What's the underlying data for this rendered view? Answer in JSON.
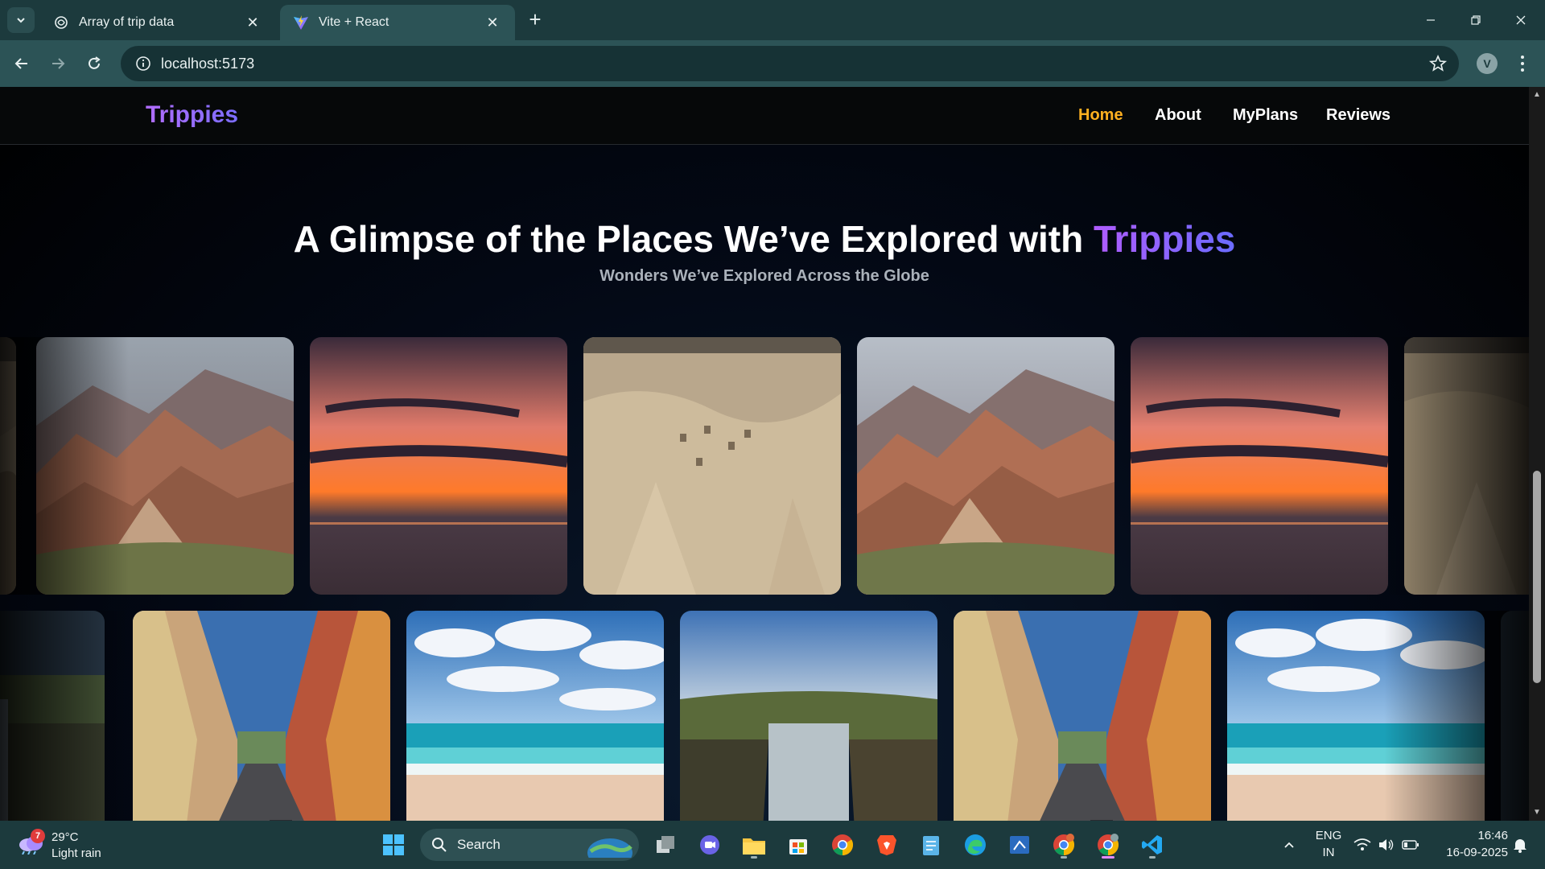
{
  "browser": {
    "tabs": [
      {
        "title": "Array of trip data",
        "favicon": "chatgpt-icon",
        "active": false
      },
      {
        "title": "Vite + React",
        "favicon": "vite-icon",
        "active": true
      }
    ],
    "address": "localhost:5173",
    "profile_initial": "V"
  },
  "site": {
    "logo": "Trippies",
    "nav": [
      {
        "label": "Home",
        "active": true
      },
      {
        "label": "About",
        "active": false
      },
      {
        "label": "MyPlans",
        "active": false
      },
      {
        "label": "Reviews",
        "active": false
      }
    ],
    "heading_main": "A Glimpse of the Places We’ve Explored with",
    "heading_accent": "Trippies",
    "subheading": "Wonders We’ve Explored Across the Globe",
    "colors": {
      "accent_purple": "#9b5cff",
      "active_nav": "#ffb020"
    }
  },
  "gallery": {
    "row1": [
      "rainbow-mountains-photo",
      "ocean-sunset-photo",
      "cappadocia-photo",
      "rainbow-mountains-photo",
      "ocean-sunset-photo",
      "cappadocia-photo"
    ],
    "row2": [
      "waterfall-photo",
      "colorful-street-photo",
      "tropical-beach-photo",
      "waterfall-photo",
      "colorful-street-photo",
      "tropical-beach-photo",
      "waterfall-photo"
    ]
  },
  "taskbar": {
    "weather_badge": "7",
    "temperature": "29°C",
    "condition": "Light rain",
    "search_label": "Search",
    "language": "ENG",
    "region": "IN",
    "time": "16:46",
    "date": "16-09-2025"
  }
}
